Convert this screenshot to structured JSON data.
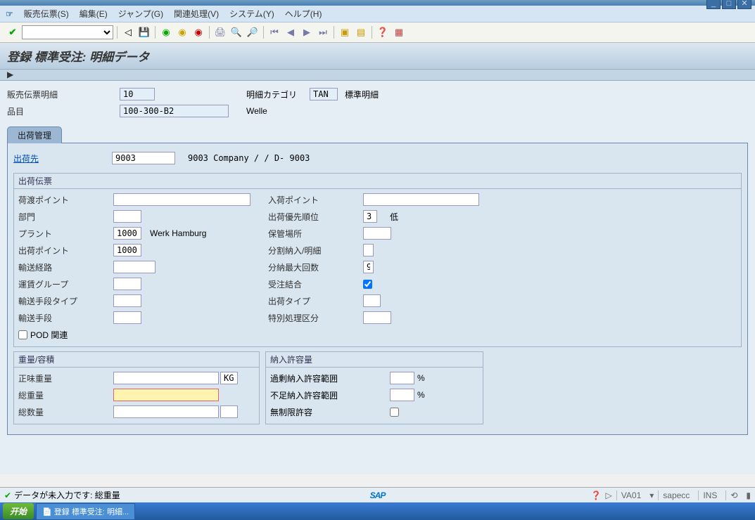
{
  "window": {
    "title": "登録 標準受注: 明細..."
  },
  "menu": {
    "items": [
      "販売伝票(S)",
      "編集(E)",
      "ジャンプ(G)",
      "関連処理(V)",
      "システム(Y)",
      "ヘルプ(H)"
    ]
  },
  "page_title": "登録 標準受注: 明細データ",
  "header": {
    "item_label": "販売伝票明細",
    "item_value": "10",
    "category_label": "明細カテゴリ",
    "category_value": "TAN",
    "category_text": "標準明細",
    "material_label": "品目",
    "material_value": "100-300-B2",
    "material_text": "Welle"
  },
  "tab": {
    "label": "出荷管理"
  },
  "ship_to": {
    "label": "出荷先",
    "value": "9003",
    "text": "9003 Company / / D- 9003"
  },
  "group_shipdoc": {
    "title": "出荷伝票",
    "left": {
      "shipping_point_label": "荷渡ポイント",
      "department_label": "部門",
      "plant_label": "プラント",
      "plant_value": "1000",
      "plant_text": "Werk Hamburg",
      "del_point_label": "出荷ポイント",
      "del_point_value": "1000",
      "route_label": "輸送経路",
      "freight_group_label": "運賃グループ",
      "trans_type_label": "輸送手段タイプ",
      "trans_means_label": "輸送手段",
      "pod_label": "POD 関連"
    },
    "right": {
      "receive_point_label": "入荷ポイント",
      "priority_label": "出荷優先順位",
      "priority_value": "3",
      "priority_text": "低",
      "storage_label": "保管場所",
      "partial_label": "分割納入/明細",
      "maxcount_label": "分納最大回数",
      "maxcount_value": "9",
      "order_comb_label": "受注結合",
      "ship_type_label": "出荷タイプ",
      "special_label": "特別処理区分"
    }
  },
  "group_weight": {
    "title": "重量/容積",
    "net_label": "正味重量",
    "uom": "KG",
    "gross_label": "総重量",
    "qty_label": "総数量"
  },
  "group_tolerance": {
    "title": "納入許容量",
    "over_label": "過剰納入許容範囲",
    "under_label": "不足納入許容範囲",
    "pct": "%",
    "unlimited_label": "無制限許容"
  },
  "status": {
    "message": "データが未入力です: 総重量",
    "tcode": "VA01",
    "system": "sapecc",
    "mode": "INS"
  },
  "taskbar": {
    "start": "开始",
    "task1": "登録 標準受注: 明細..."
  }
}
